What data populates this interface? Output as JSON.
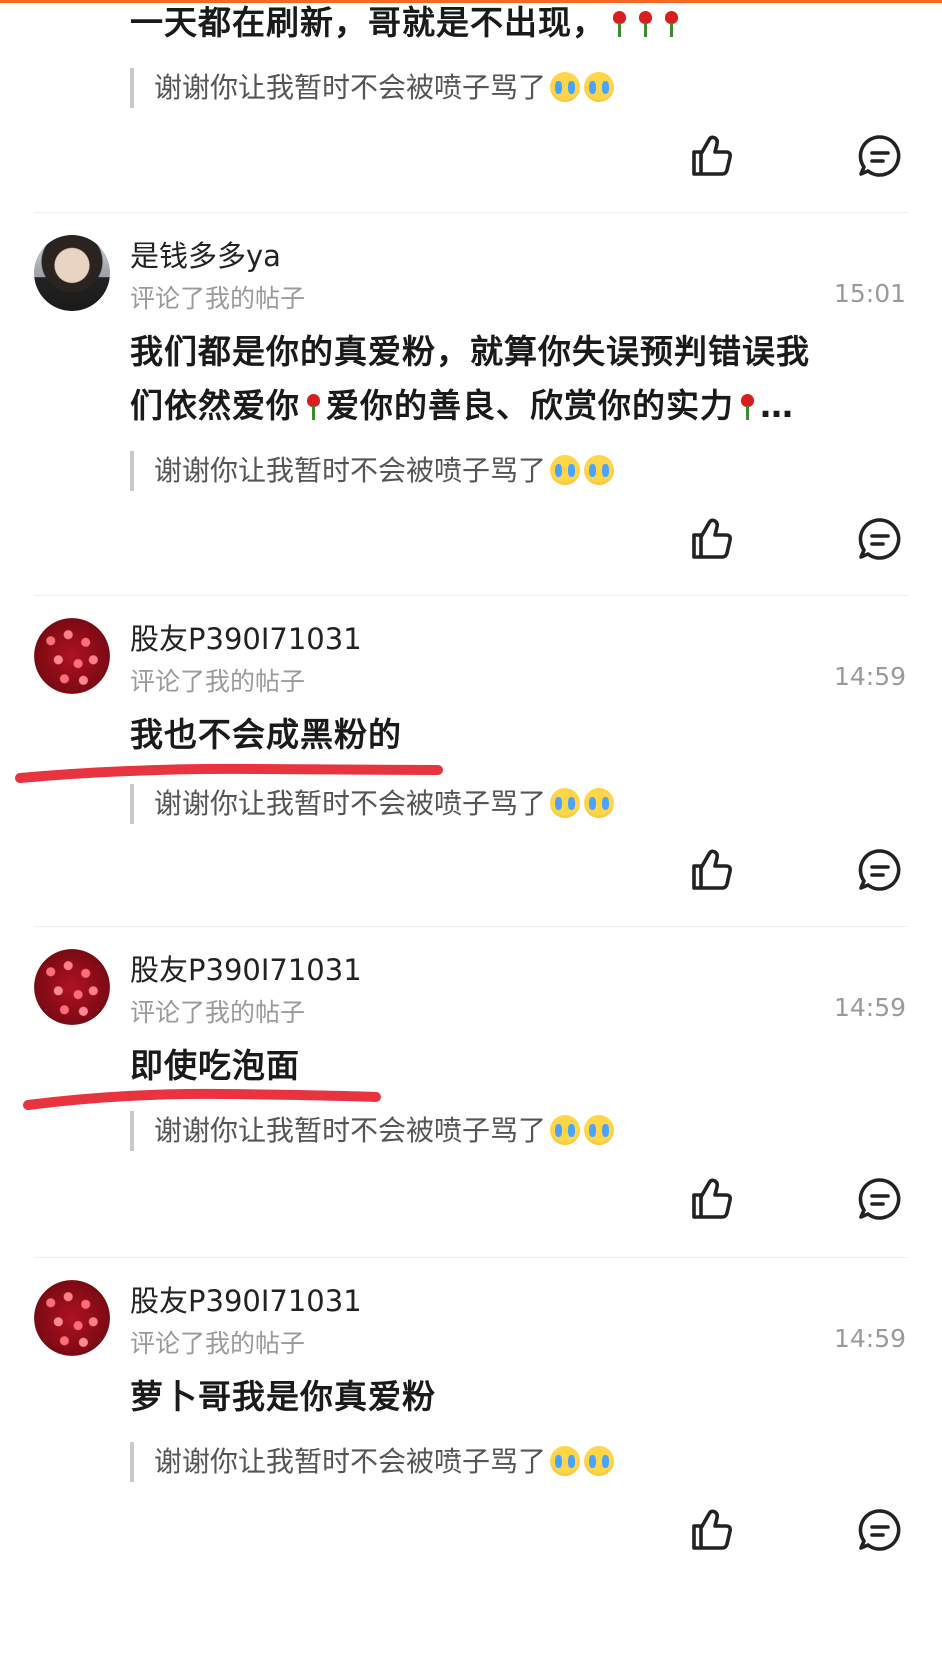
{
  "top_partial": {
    "content": "一天都在刷新，哥就是不出现，",
    "reply": "谢谢你让我暂时不会被喷子骂了"
  },
  "comments": [
    {
      "username": "是钱多多ya",
      "action": "评论了我的帖子",
      "time": "15:01",
      "content_line1": "我们都是你的真爱粉，就算你失误预判错误我",
      "content_line2a": "们依然爱你",
      "content_line2b": "爱你的善良、欣赏你的实力",
      "content_line2c": "…",
      "reply": "谢谢你让我暂时不会被喷子骂了"
    },
    {
      "username": "股友P390I71031",
      "action": "评论了我的帖子",
      "time": "14:59",
      "content": "我也不会成黑粉的",
      "reply": "谢谢你让我暂时不会被喷子骂了"
    },
    {
      "username": "股友P390I71031",
      "action": "评论了我的帖子",
      "time": "14:59",
      "content": "即使吃泡面",
      "reply": "谢谢你让我暂时不会被喷子骂了"
    },
    {
      "username": "股友P390I71031",
      "action": "评论了我的帖子",
      "time": "14:59",
      "content": "萝卜哥我是你真爱粉",
      "reply": "谢谢你让我暂时不会被喷子骂了"
    }
  ],
  "icons": {
    "like": "thumbs-up-icon",
    "comment": "comment-bubble-icon",
    "emoji": "loudly-crying-face-emoji",
    "rose": "rose-emoji"
  },
  "colors": {
    "accent": "#f26a21",
    "annotation": "#e8343f",
    "muted_text": "#9a9a9a"
  }
}
